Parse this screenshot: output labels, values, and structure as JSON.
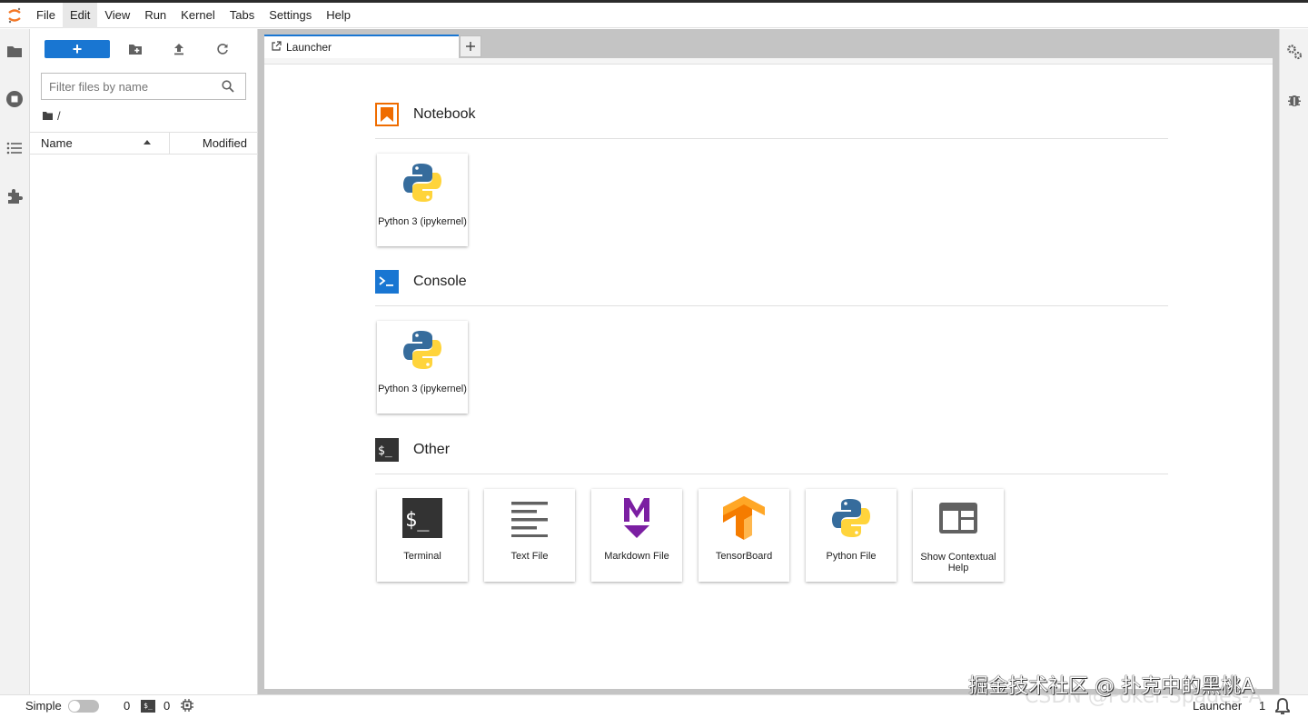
{
  "menu": [
    "File",
    "Edit",
    "View",
    "Run",
    "Kernel",
    "Tabs",
    "Settings",
    "Help"
  ],
  "menu_active": "Edit",
  "filebrowser": {
    "new_label": "+",
    "filter_placeholder": "Filter files by name",
    "breadcrumb": "/",
    "col_name": "Name",
    "col_modified": "Modified"
  },
  "tabs": [
    {
      "label": "Launcher",
      "active": true
    }
  ],
  "launcher": {
    "notebook": {
      "title": "Notebook",
      "cards": [
        {
          "label": "Python 3 (ipykernel)",
          "icon": "python-icon"
        }
      ]
    },
    "console": {
      "title": "Console",
      "cards": [
        {
          "label": "Python 3 (ipykernel)",
          "icon": "python-icon"
        }
      ]
    },
    "other": {
      "title": "Other",
      "cards": [
        {
          "label": "Terminal",
          "icon": "terminal-icon"
        },
        {
          "label": "Text File",
          "icon": "text-file-icon"
        },
        {
          "label": "Markdown File",
          "icon": "markdown-icon"
        },
        {
          "label": "TensorBoard",
          "icon": "tensorboard-icon"
        },
        {
          "label": "Python File",
          "icon": "python-icon"
        },
        {
          "label": "Show Contextual Help",
          "icon": "contextual-help-icon"
        }
      ]
    }
  },
  "statusbar": {
    "mode": "Simple",
    "kernels": "0",
    "terminals": "0",
    "active": "Launcher",
    "count": "1"
  },
  "watermark": "掘金技术社区 @ 扑克中的黑桃A",
  "watermark2": "CSDN @Poker-Spades-A",
  "colors": {
    "accent": "#1976d2",
    "notebook": "#ef6c00",
    "console": "#1976d2",
    "markdown": "#7b1fa2",
    "tensorboard": "#f57c00"
  }
}
